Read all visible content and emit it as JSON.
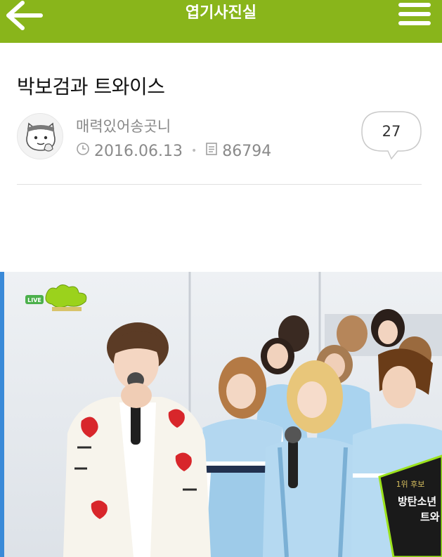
{
  "header": {
    "title": "엽기사진실",
    "back_icon": "arrow-left-icon",
    "menu_icon": "hamburger-menu-icon",
    "color": "#89b51b"
  },
  "post": {
    "title": "박보검과 트와이스",
    "author": "매력있어송곳니",
    "date": "2016.06.13",
    "views": "86794",
    "comments": "27"
  },
  "image": {
    "broadcast_badge": "LIVE",
    "overlay_tag": "1위 후보",
    "overlay_line1": "방탄소년",
    "overlay_line2": "트와"
  }
}
